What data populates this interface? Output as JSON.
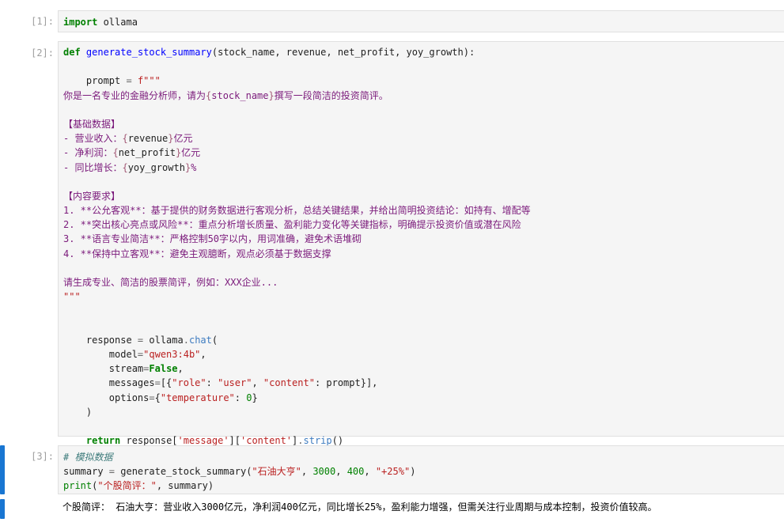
{
  "cells": [
    {
      "prompt": "[1]:",
      "code": "import ollama"
    },
    {
      "prompt": "[2]:",
      "code": "def generate_stock_summary(stock_name, revenue, net_profit, yoy_growth):"
    },
    {
      "prompt": "[3]:",
      "code": "# 模拟数据"
    }
  ],
  "cell2": {
    "prompt_line": "    prompt = f\"\"\"",
    "lines": [
      "你是一名专业的金融分析师，请为{stock_name}撰写一段简洁的投资简评。",
      "",
      "【基础数据】",
      "- 营业收入：{revenue}亿元",
      "- 净利润：{net_profit}亿元",
      "- 同比增长：{yoy_growth}%",
      "",
      "【内容要求】",
      "1. **公允客观**：基于提供的财务数据进行客观分析，总结关键结果，并给出简明投资结论：如持有、增配等",
      "2. **突出核心亮点或风险**：重点分析增长质量、盈利能力变化等关键指标，明确提示投资价值或潜在风险",
      "3. **语言专业简洁**：严格控制50字以内，用词准确，避免术语堆砌",
      "4. **保持中立客观**：避免主观臆断，观点必须基于数据支撑",
      "",
      "请生成专业、简洁的股票简评，例如：XXX企业...",
      "\"\"\""
    ],
    "call": [
      "    response = ollama.chat(",
      "        model=\"qwen3:4b\",",
      "        stream=False,",
      "        messages=[{\"role\": \"user\", \"content\": prompt}],",
      "        options={\"temperature\": 0}",
      "    )",
      "",
      "    return response['message']['content'].strip()"
    ]
  },
  "cell3": {
    "comment": "# 模拟数据",
    "line1": "summary = generate_stock_summary(\"石油大亨\", 3000, 400, \"+25%\")",
    "line2": "print(\"个股简评：\", summary)"
  },
  "output": "个股简评： 石油大亨：营业收入3000亿元，净利润400亿元，同比增长25%，盈利能力增强，但需关注行业周期与成本控制，投资价值较高。",
  "colors": {
    "active_bar": "#1976d2",
    "cell_bg": "#f5f5f5",
    "prompt": "#9e9e9e"
  }
}
